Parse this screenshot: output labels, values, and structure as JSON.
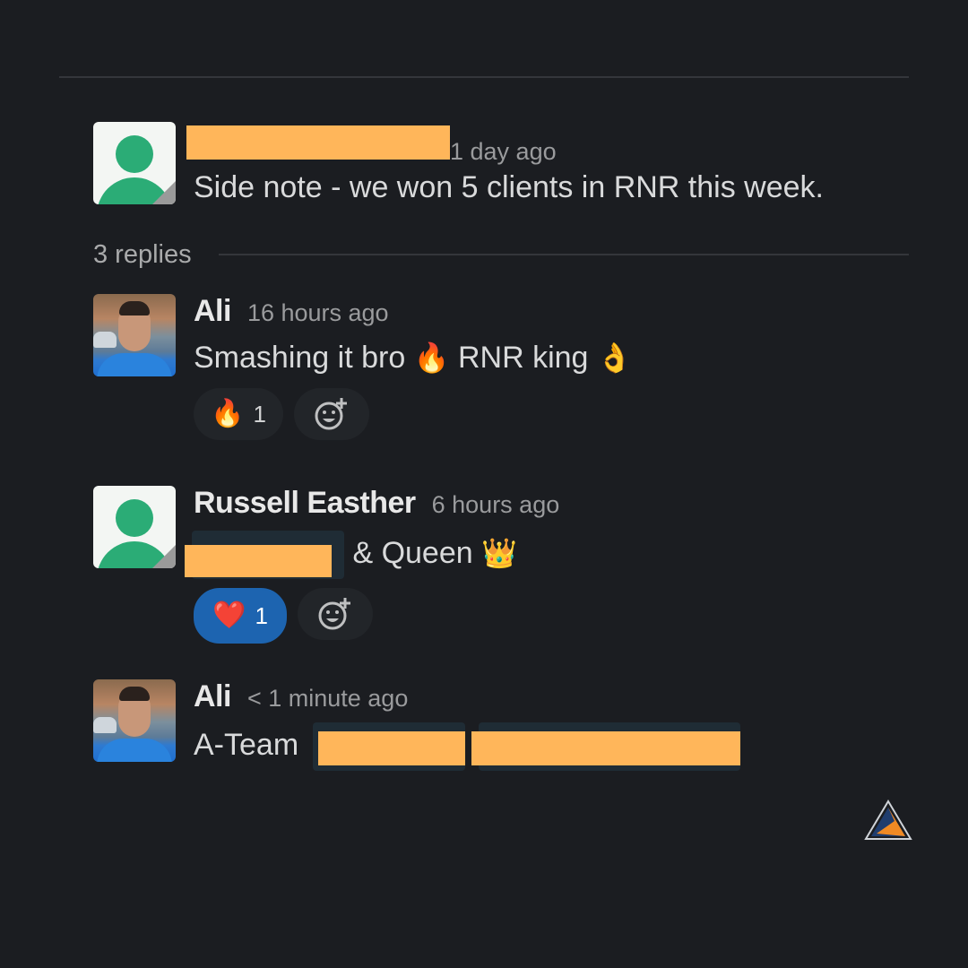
{
  "thread": {
    "parent": {
      "author_redacted": true,
      "time": "1 day ago",
      "text": "Side note - we won 5 clients in RNR this week."
    },
    "replies_count_label": "3 replies",
    "replies": [
      {
        "author": "Ali",
        "time": "16 hours ago",
        "text_a": "Smashing it bro",
        "emoji_a": "🔥",
        "text_b": "RNR king",
        "emoji_b": "👌",
        "reaction": {
          "emoji": "🔥",
          "count": "1",
          "active": false
        },
        "add_reaction_icon": "add-reaction-icon"
      },
      {
        "author": "Russell Easther",
        "time": "6 hours ago",
        "text": "& Queen",
        "emoji": "👑",
        "reaction": {
          "emoji": "❤️",
          "count": "1",
          "active": true
        },
        "add_reaction_icon": "add-reaction-icon"
      },
      {
        "author": "Ali",
        "time": "< 1 minute ago",
        "text": "A-Team"
      }
    ]
  },
  "colors": {
    "background": "#1b1d21",
    "redaction": "#ffb65a",
    "active_reaction": "#1d64b0",
    "avatar_green": "#2bac76"
  },
  "logo_icon": "triangle-logo-icon"
}
